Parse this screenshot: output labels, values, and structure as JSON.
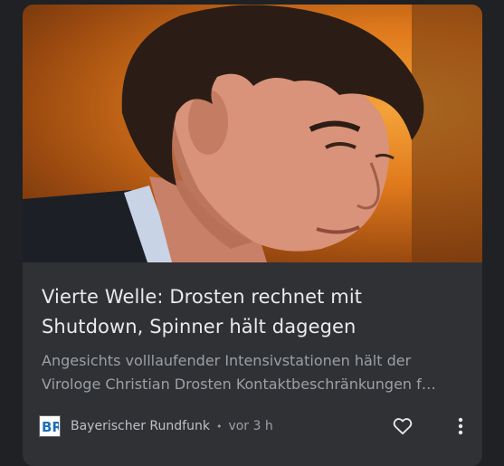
{
  "article": {
    "headline": "Vierte Welle: Drosten rechnet mit Shutdown, Spinner hält dagegen",
    "snippet_line1": "Angesichts volllaufender Intensivstationen hält der",
    "snippet_line2": "Virologe Christian Drosten Kontaktbeschränkungen f…"
  },
  "source": {
    "name": "Bayerischer Rundfunk",
    "separator": "•",
    "time": "vor 3 h",
    "logo_text": "BR"
  },
  "icons": {
    "like": "heart-outline-icon",
    "more": "more-vert-icon"
  },
  "colors": {
    "background": "#202124",
    "card": "#303134",
    "headline": "#e8eaed",
    "snippet": "#9aa0a6",
    "br_blue": "#1f6fb5"
  }
}
